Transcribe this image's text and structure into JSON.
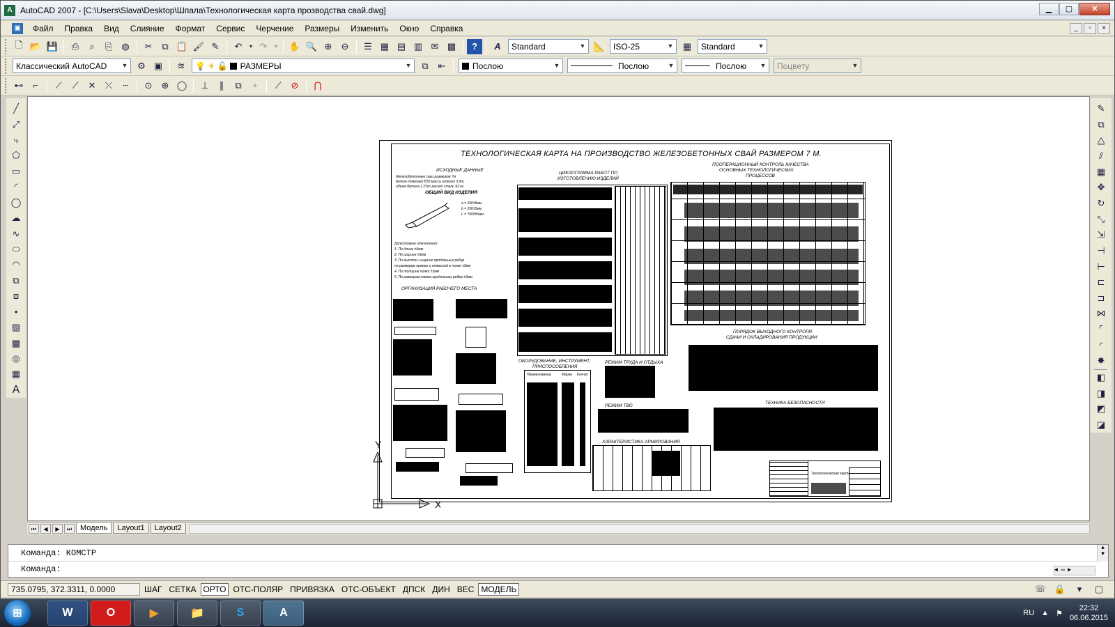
{
  "window": {
    "title": "AutoCAD 2007 - [C:\\Users\\Slava\\Desktop\\Шпала\\Технологическая карта прозводства свай.dwg]",
    "min_glyph": "▁",
    "max_glyph": "▢",
    "close_glyph": "✕"
  },
  "menu": {
    "items": [
      "Файл",
      "Правка",
      "Вид",
      "Слияние",
      "Формат",
      "Сервис",
      "Черчение",
      "Размеры",
      "Изменить",
      "Окно",
      "Справка"
    ]
  },
  "toolbar": {
    "text_style": "Standard",
    "dim_style": "ISO-25",
    "table_style": "Standard",
    "workspace": "Классический AutoCAD",
    "layer": "РАЗМЕРЫ",
    "color": "Послою",
    "linetype": "Послою",
    "lineweight": "Послою",
    "plotstyle": "Поцвету"
  },
  "drawing": {
    "sheet_title": "ТЕХНОЛОГИЧЕСКАЯ КАРТА НА ПРОИЗВОДСТВО ЖЕЛЕЗОБЕТОННЫХ СВАЙ РАЗМЕРОМ 7 М.",
    "section_source": "ИСХОДНЫЕ ДАННЫЕ",
    "source_text1": "Железобетонные сваи размером 7м",
    "source_text2": "Бетон тяжелый В30 масса изделия 3,9т,",
    "source_text3": "объем бетона 1,07м³ расход стали 92 кг.",
    "section_view": "ОБЩИЙ ВИД ИЗДЕЛИЯ",
    "dim_a": "а = 250±5мм",
    "dim_b": "b = 250±5мм",
    "dim_l": "L = 7000±6мм",
    "section_deviations": "Допустимые отклонения:",
    "dev1": "1. По длине ±6мм",
    "dev2": "2. По ширине ±5мм",
    "dev3": "3. По высоте и ширине продольных ребер",
    "dev3b": "по размерам прямое и отвесной в полке ±3мм",
    "dev4": "4. По толщине полки ±3мм",
    "dev5": "5. По размерам также продольных ребер ±3мм",
    "section_workplace": "ОРГАНИЗАЦИЯ РАБОЧЕГО МЕСТА",
    "section_cyclogram": "ЦИКЛОГРАММА РАБОТ ПО",
    "section_cyclogram2": "ИЗГОТОВЛЕНИЮ ИЗДЕЛИЙ",
    "section_quality": "ПООПЕРАЦИОННЫЙ КОНТРОЛЬ КАЧЕСТВА",
    "section_quality2": "ОСНОВНЫХ ТЕХНОЛОГИЧЕСКИХ",
    "section_quality3": "ПРОЦЕССОВ",
    "section_output": "ПОРЯДОК ВЫХОДНОГО КОНТРОЛЯ,",
    "section_output2": "СДАЧИ И СКЛАДИРОВАНИЯ ПРОДУКЦИИ",
    "section_equipment": "ОБОРУДОВАНИЕ, ИНСТРУМЕНТ,",
    "section_equipment2": "ПРИСПОСОБЛЕНИЯ",
    "eq_col1": "Наименование",
    "eq_col2": "Марка",
    "eq_col3": "Кол-во",
    "section_labor": "РЕЖИМ ТРУДА И ОТДЫХА",
    "section_tvo": "РЕЖИМ ТВО",
    "section_reinf": "ХАРАКТЕРИСТИКА АРМИРОВАНИЯ",
    "section_safety": "ТЕХНИКА БЕЗОПАСНОСТИ",
    "stamp_text": "Технологическая карта",
    "ucs_y": "Y",
    "ucs_x": "X"
  },
  "tabs": {
    "model": "Модель",
    "layout1": "Layout1",
    "layout2": "Layout2"
  },
  "command": {
    "line1": "Команда:  КОМСТР",
    "line2": "Команда:"
  },
  "status": {
    "coords": "735.0795, 372.3311, 0.0000",
    "buttons": [
      "ШАГ",
      "СЕТКА",
      "ОРТО",
      "ОТС-ПОЛЯР",
      "ПРИВЯЗКА",
      "ОТС-ОБЪЕКТ",
      "ДПСК",
      "ДИН",
      "ВЕС",
      "МОДЕЛЬ"
    ]
  },
  "taskbar": {
    "lang": "RU",
    "time": "22:32",
    "date": "06.06.2015"
  }
}
